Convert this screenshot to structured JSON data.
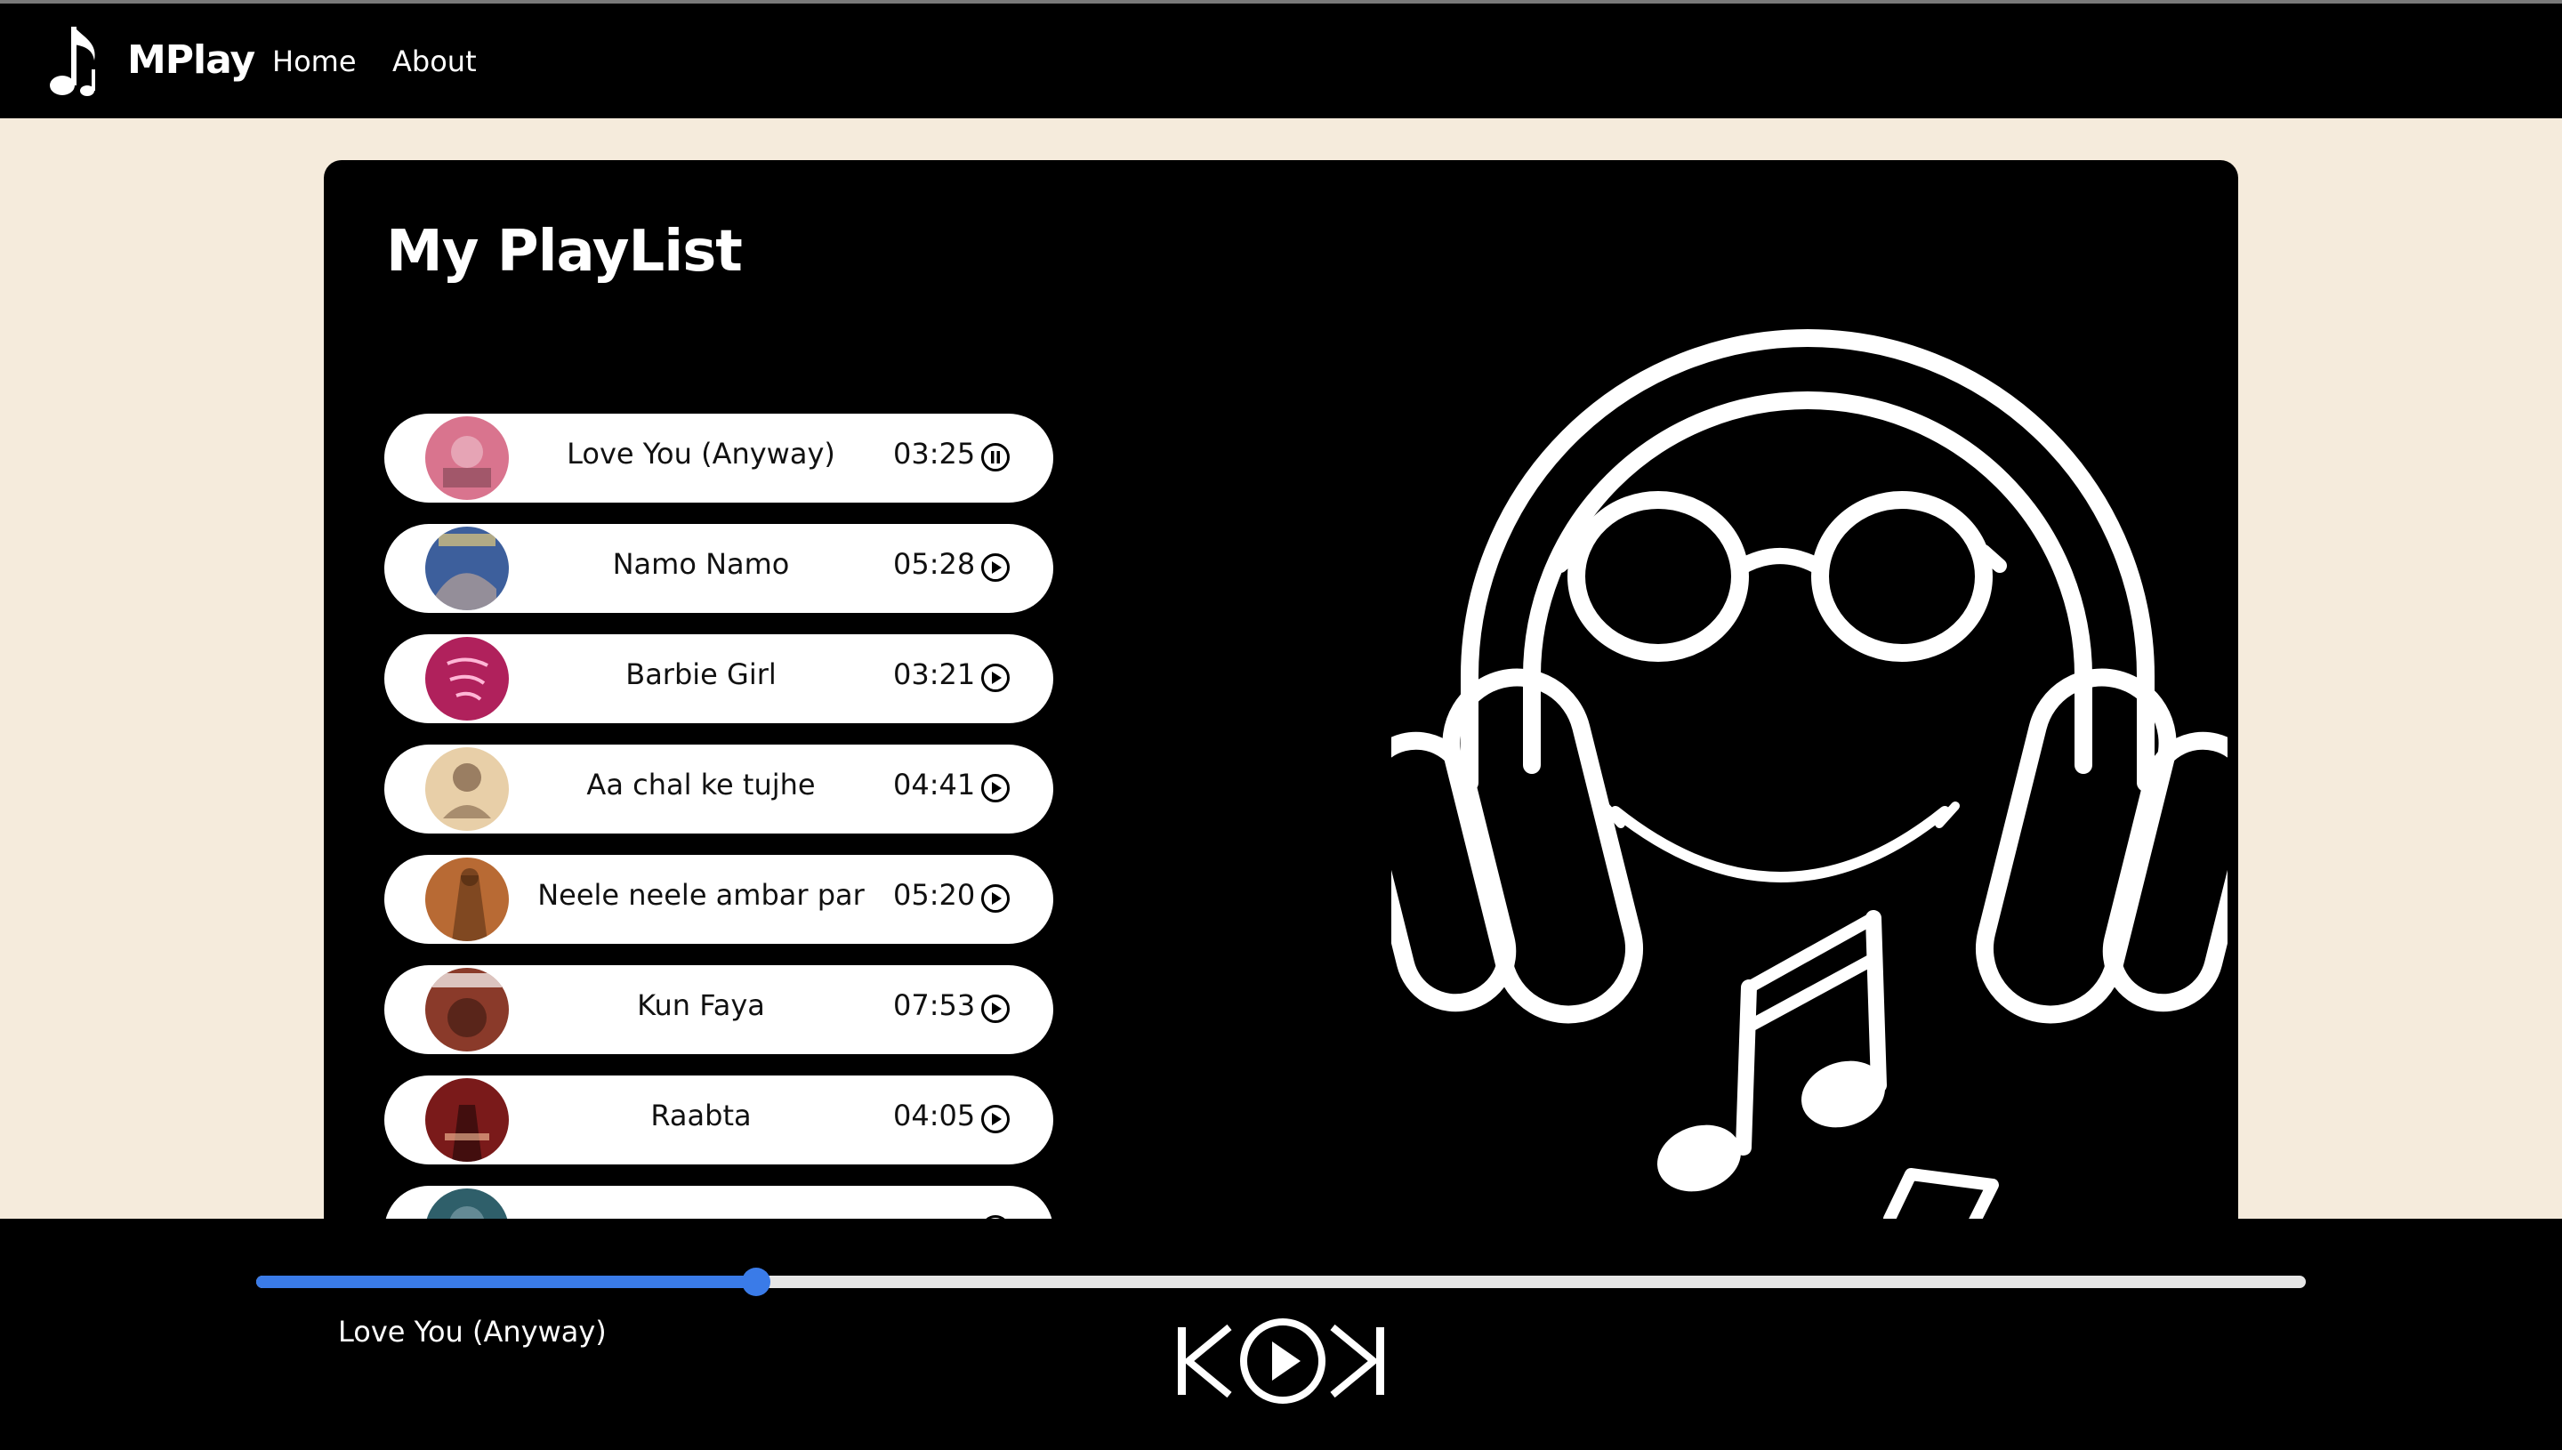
{
  "app": {
    "brand": "MPlay",
    "nav": [
      {
        "label": "Home"
      },
      {
        "label": "About"
      }
    ]
  },
  "playlist": {
    "title": "My PlayList",
    "songs": [
      {
        "name": "Love You (Anyway)",
        "duration": "03:25",
        "state": "pause-icon",
        "cover_color": "#d9748e"
      },
      {
        "name": "Namo Namo",
        "duration": "05:28",
        "state": "play-icon",
        "cover_color": "#3d5f9c"
      },
      {
        "name": "Barbie Girl",
        "duration": "03:21",
        "state": "play-icon",
        "cover_color": "#b0215c"
      },
      {
        "name": "Aa chal ke tujhe",
        "duration": "04:41",
        "state": "play-icon",
        "cover_color": "#e8cfa8"
      },
      {
        "name": "Neele neele ambar par",
        "duration": "05:20",
        "state": "play-icon",
        "cover_color": "#b86a34"
      },
      {
        "name": "Kun Faya",
        "duration": "07:53",
        "state": "play-icon",
        "cover_color": "#8a3a2a"
      },
      {
        "name": "Raabta",
        "duration": "04:05",
        "state": "play-icon",
        "cover_color": "#7a1a1a"
      },
      {
        "name": "",
        "duration": "",
        "state": "play-icon",
        "cover_color": "#2f5f6a"
      }
    ]
  },
  "player": {
    "now_playing": "Love You (Anyway)",
    "progress": 0.244,
    "accent_color": "#3a7be8",
    "controls": [
      "previous-icon",
      "play-icon",
      "next-icon"
    ]
  }
}
